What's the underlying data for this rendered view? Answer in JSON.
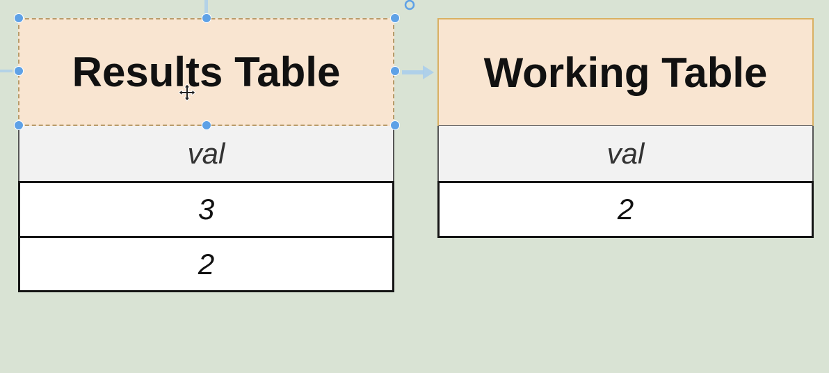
{
  "results_table": {
    "title": "Results Table",
    "column": "val",
    "rows": [
      "3",
      "2"
    ]
  },
  "working_table": {
    "title": "Working Table",
    "column": "val",
    "rows": [
      "2"
    ]
  },
  "colors": {
    "canvas": "#d9e3d4",
    "header_fill": "#f9e5d1",
    "selection_handle": "#5ea1e6",
    "working_border": "#d9b062"
  },
  "icons": [
    "selection-handle",
    "rotate-handle-icon",
    "move-cursor-icon",
    "arrow-right-icon"
  ]
}
